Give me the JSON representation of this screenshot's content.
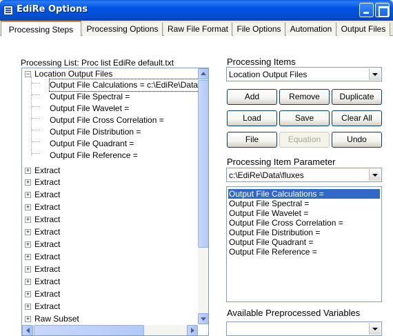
{
  "window": {
    "title": "EdiRe Options"
  },
  "tabs": [
    {
      "label": "Processing Steps",
      "active": true
    },
    {
      "label": "Processing Options",
      "active": false
    },
    {
      "label": "Raw File Format",
      "active": false
    },
    {
      "label": "File Options",
      "active": false
    },
    {
      "label": "Automation",
      "active": false
    },
    {
      "label": "Output Files",
      "active": false
    }
  ],
  "processing_list": {
    "label": "Processing List: Proc list EdiRe default.txt",
    "group": {
      "label": "Location Output Files",
      "expanded": true,
      "expander": "−"
    },
    "children": [
      "Output File Calculations = c:\\EdiRe\\Data\\",
      "Output File Spectral =",
      "Output File Wavelet =",
      "Output File Cross Correlation =",
      "Output File Distribution =",
      "Output File Quadrant =",
      "Output File Reference ="
    ],
    "collapsed_nodes": [
      "Extract",
      "Extract",
      "Extract",
      "Extract",
      "Extract",
      "Extract",
      "Extract",
      "Extract",
      "Extract",
      "Extract",
      "Extract",
      "Extract",
      "Raw Subset"
    ],
    "collapsed_expander": "+"
  },
  "processing_items": {
    "label": "Processing Items",
    "selected": "Location Output Files"
  },
  "buttons": {
    "add": "Add",
    "remove": "Remove",
    "duplicate": "Duplicate",
    "load": "Load",
    "save": "Save",
    "clear_all": "Clear All",
    "file": "File",
    "equation": "Equation",
    "undo": "Undo"
  },
  "processing_item_parameter": {
    "label": "Processing Item Parameter",
    "value": "c:\\EdiRe\\Data\\fluxes"
  },
  "parameter_list": {
    "items": [
      "Output File Calculations =",
      "Output File Spectral =",
      "Output File Wavelet =",
      "Output File Cross Correlation =",
      "Output File Distribution =",
      "Output File Quadrant =",
      "Output File Reference ="
    ],
    "selected_index": 0
  },
  "available_preprocessed_variables": {
    "label": "Available Preprocessed Variables",
    "value": ""
  },
  "colors": {
    "titlebar": "#0054e3",
    "selection": "#316ac5",
    "active_tab_accent": "#e68b2c"
  }
}
